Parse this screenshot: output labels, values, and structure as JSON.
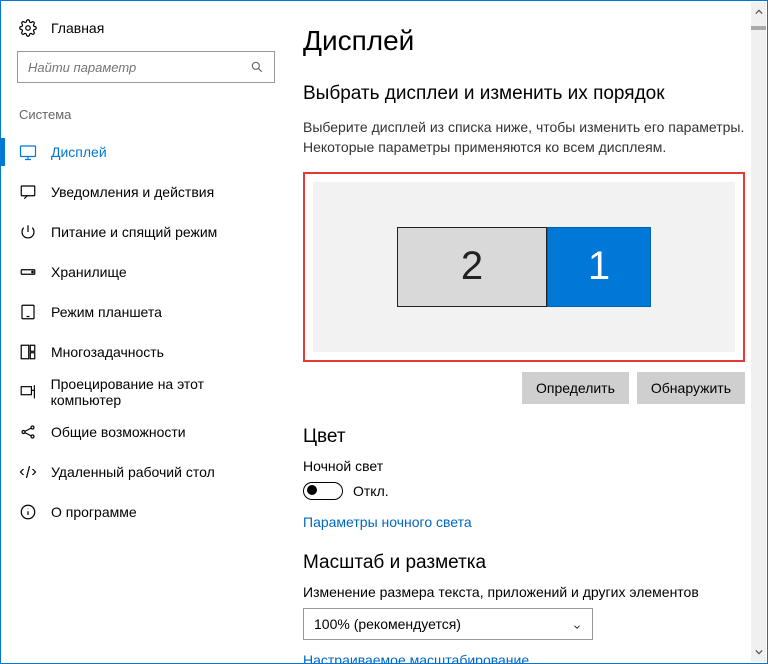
{
  "sidebar": {
    "home": "Главная",
    "search_placeholder": "Найти параметр",
    "group": "Система",
    "items": [
      {
        "label": "Дисплей",
        "active": true
      },
      {
        "label": "Уведомления и действия"
      },
      {
        "label": "Питание и спящий режим"
      },
      {
        "label": "Хранилище"
      },
      {
        "label": "Режим планшета"
      },
      {
        "label": "Многозадачность"
      },
      {
        "label": "Проецирование на этот компьютер"
      },
      {
        "label": "Общие возможности"
      },
      {
        "label": "Удаленный рабочий стол"
      },
      {
        "label": "О программе"
      }
    ]
  },
  "main": {
    "title": "Дисплей",
    "select_head": "Выбрать дисплеи и изменить их порядок",
    "select_hint": "Выберите дисплей из списка ниже, чтобы изменить его параметры. Некоторые параметры применяются ко всем дисплеям.",
    "displays": {
      "secondary": "2",
      "primary": "1"
    },
    "identify": "Определить",
    "detect": "Обнаружить",
    "color_head": "Цвет",
    "nightlight_label": "Ночной свет",
    "nightlight_state": "Откл.",
    "nightlight_link": "Параметры ночного света",
    "scale_head": "Масштаб и разметка",
    "scale_label": "Изменение размера текста, приложений и других элементов",
    "scale_value": "100% (рекомендуется)",
    "scale_link": "Настраиваемое масштабирование"
  }
}
